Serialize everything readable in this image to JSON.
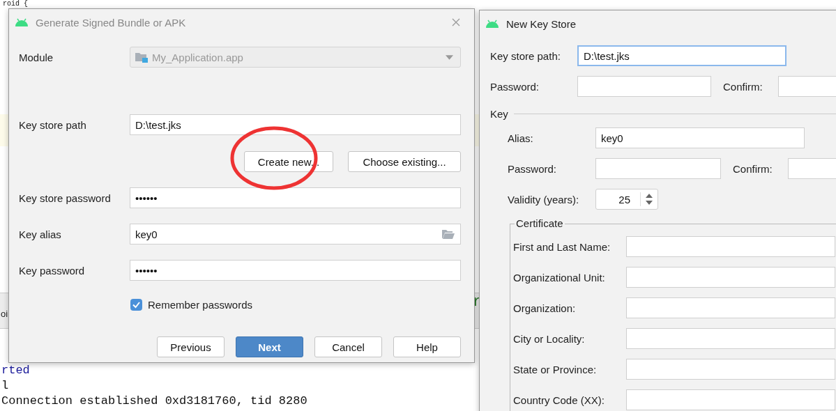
{
  "editor": {
    "lines": [
      "roid {",
      "rted",
      "l",
      "Connection established 0xd3181760, tid 8280"
    ],
    "toolbar_text": "oi",
    "side_text": "r"
  },
  "signed_dialog": {
    "title": "Generate Signed Bundle or APK",
    "module": {
      "label": "Module",
      "value": "My_Application.app",
      "disabled": true
    },
    "key_store_path": {
      "label": "Key store path",
      "value": "D:\\test.jks"
    },
    "store_buttons": [
      "Create new...",
      "Choose existing..."
    ],
    "key_store_password": {
      "label": "Key store password",
      "value": "••••••"
    },
    "key_alias": {
      "label": "Key alias",
      "value": "key0"
    },
    "key_password": {
      "label": "Key password",
      "value": "••••••"
    },
    "remember_passwords": {
      "label": "Remember passwords",
      "checked": true
    },
    "buttons": [
      {
        "label": "Previous",
        "default": false
      },
      {
        "label": "Next",
        "default": true
      },
      {
        "label": "Cancel",
        "default": false
      },
      {
        "label": "Help",
        "default": false
      }
    ]
  },
  "new_key_store": {
    "title": "New Key Store",
    "key_store_path": {
      "label": "Key store path:",
      "value": "D:\\test.jks",
      "focused": true
    },
    "password": {
      "label": "Password:"
    },
    "confirm": {
      "label": "Confirm:"
    },
    "key_section": "Key",
    "alias": {
      "label": "Alias:",
      "value": "key0"
    },
    "key_password": {
      "label": "Password:"
    },
    "key_confirm": {
      "label": "Confirm:"
    },
    "validity": {
      "label": "Validity (years):",
      "value": "25"
    },
    "certificate": {
      "title": "Certificate",
      "fields": [
        {
          "label": "First and Last Name:"
        },
        {
          "label": "Organizational Unit:"
        },
        {
          "label": "Organization:"
        },
        {
          "label": "City or Locality:"
        },
        {
          "label": "State or Province:"
        },
        {
          "label": "Country Code (XX):"
        }
      ]
    }
  }
}
